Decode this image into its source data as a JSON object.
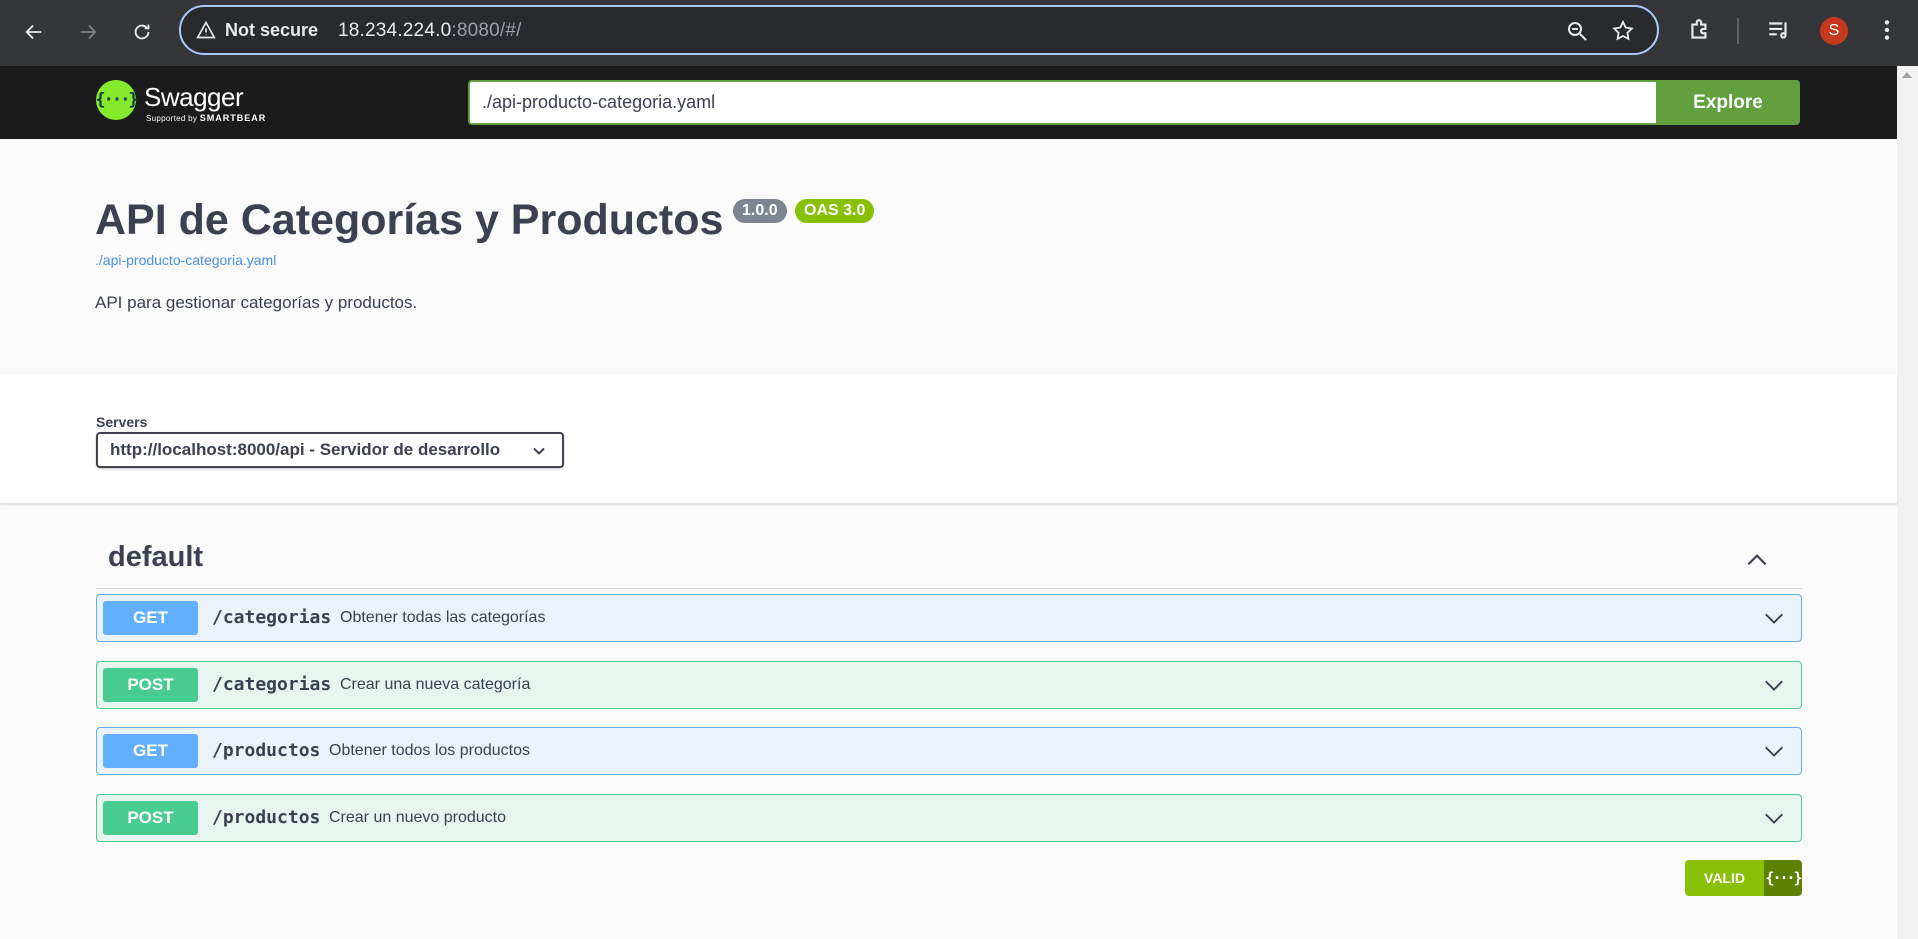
{
  "browser": {
    "security_label": "Not secure",
    "url_host": "18.234.224.0",
    "url_rest": ":8080/#/",
    "avatar_letter": "S"
  },
  "swagger": {
    "logo_word": "Swagger",
    "logo_tagline_small": "Supported by",
    "logo_tagline_brand": "SMARTBEAR",
    "logo_glyph": "{···}",
    "spec_url_value": "./api-producto-categoria.yaml",
    "explore_label": "Explore"
  },
  "info": {
    "title": "API de Categorías y Productos",
    "version_badge": "1.0.0",
    "oas_badge": "OAS 3.0",
    "spec_link": "./api-producto-categoria.yaml",
    "description": "API para gestionar categorías y productos."
  },
  "servers": {
    "label": "Servers",
    "selected": "http://localhost:8000/api - Servidor de desarrollo"
  },
  "tag": {
    "name": "default"
  },
  "operations": [
    {
      "method": "GET",
      "path": "/categorias",
      "summary": "Obtener todas las categorías"
    },
    {
      "method": "POST",
      "path": "/categorias",
      "summary": "Crear una nueva categoría"
    },
    {
      "method": "GET",
      "path": "/productos",
      "summary": "Obtener todos los productos"
    },
    {
      "method": "POST",
      "path": "/productos",
      "summary": "Crear un nuevo producto"
    }
  ],
  "validator": {
    "label": "VALID",
    "glyph": "{···}"
  },
  "colors": {
    "get": "#61affe",
    "post": "#49cc90",
    "explore": "#62a03f",
    "oas": "#89bf04"
  },
  "icons": [
    "back-arrow-icon",
    "forward-arrow-icon",
    "reload-icon",
    "warning-icon",
    "zoom-icon",
    "star-icon",
    "extensions-icon",
    "media-icon",
    "kebab-menu-icon",
    "chevron-down-icon",
    "chevron-up-icon"
  ]
}
